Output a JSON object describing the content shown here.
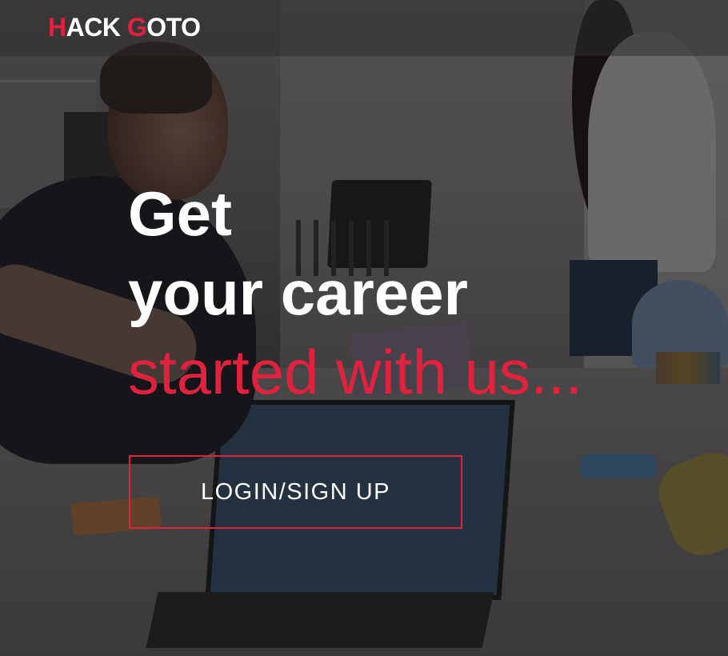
{
  "header": {
    "logo": {
      "first_initial": "H",
      "first_rest": "ACK ",
      "second_initial": "G",
      "second_rest": "OTO"
    }
  },
  "hero": {
    "headline_line_1": "Get",
    "headline_line_2": "your career",
    "headline_line_3": "started with us...",
    "cta_label": "LOGIN/SIGN UP"
  },
  "colors": {
    "accent": "#e0223e",
    "text": "#ffffff"
  }
}
